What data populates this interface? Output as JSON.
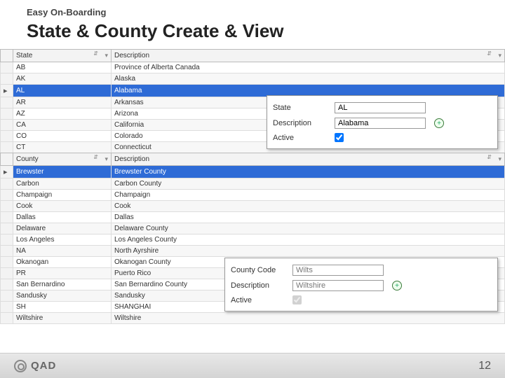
{
  "header": {
    "sub": "Easy On-Boarding",
    "title": "State & County Create & View"
  },
  "state_grid": {
    "headers": {
      "c0": "State",
      "c1": "Description"
    },
    "rows": [
      {
        "code": "AB",
        "desc": "Province of Alberta Canada"
      },
      {
        "code": "AK",
        "desc": "Alaska"
      },
      {
        "code": "AL",
        "desc": "Alabama",
        "sel": true
      },
      {
        "code": "AR",
        "desc": "Arkansas"
      },
      {
        "code": "AZ",
        "desc": "Arizona"
      },
      {
        "code": "CA",
        "desc": "California"
      },
      {
        "code": "CO",
        "desc": "Colorado"
      },
      {
        "code": "CT",
        "desc": "Connecticut"
      }
    ]
  },
  "county_grid": {
    "headers": {
      "c0": "County",
      "c1": "Description"
    },
    "rows": [
      {
        "code": "Brewster",
        "desc": "Brewster County",
        "sel": true
      },
      {
        "code": "Carbon",
        "desc": "Carbon County"
      },
      {
        "code": "Champaign",
        "desc": "Champaign"
      },
      {
        "code": "Cook",
        "desc": "Cook"
      },
      {
        "code": "Dallas",
        "desc": "Dallas"
      },
      {
        "code": "Delaware",
        "desc": "Delaware County"
      },
      {
        "code": "Los Angeles",
        "desc": "Los Angeles County"
      },
      {
        "code": "NA",
        "desc": "North Ayrshire"
      },
      {
        "code": "Okanogan",
        "desc": "Okanogan County"
      },
      {
        "code": "PR",
        "desc": "Puerto Rico"
      },
      {
        "code": "San Bernardino",
        "desc": "San Bernardino County"
      },
      {
        "code": "Sandusky",
        "desc": "Sandusky"
      },
      {
        "code": "SH",
        "desc": "SHANGHAI"
      },
      {
        "code": "Wiltshire",
        "desc": "Wiltshire"
      }
    ]
  },
  "state_panel": {
    "labels": {
      "state": "State",
      "desc": "Description",
      "active": "Active"
    },
    "values": {
      "state": "AL",
      "desc": "Alabama",
      "active": true
    }
  },
  "county_panel": {
    "labels": {
      "code": "County Code",
      "desc": "Description",
      "active": "Active"
    },
    "values": {
      "code": "Wilts",
      "desc": "Wiltshire",
      "active": true
    }
  },
  "footer": {
    "brand": "QAD",
    "page": "12"
  },
  "icons": {
    "sort": "⇵",
    "filter": "▾",
    "pointer": "▸",
    "plus": "+"
  }
}
